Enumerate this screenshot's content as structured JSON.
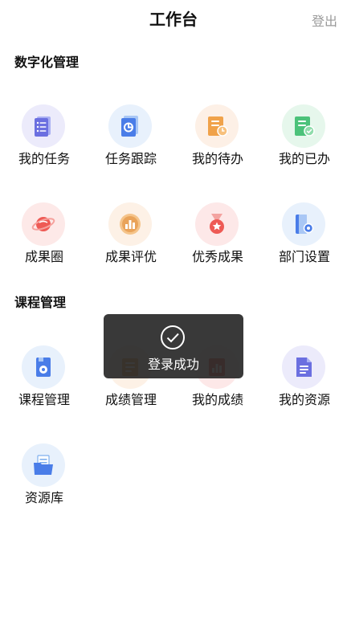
{
  "header": {
    "title": "工作台",
    "logout_label": "登出"
  },
  "sections": {
    "digital": {
      "title": "数字化管理",
      "items": [
        {
          "label": "我的任务",
          "icon": "task-list-icon"
        },
        {
          "label": "任务跟踪",
          "icon": "tracking-icon"
        },
        {
          "label": "我的待办",
          "icon": "todo-clock-icon"
        },
        {
          "label": "我的已办",
          "icon": "done-check-icon"
        },
        {
          "label": "成果圈",
          "icon": "planet-icon"
        },
        {
          "label": "成果评优",
          "icon": "award-chart-icon"
        },
        {
          "label": "优秀成果",
          "icon": "medal-icon"
        },
        {
          "label": "部门设置",
          "icon": "department-settings-icon"
        }
      ]
    },
    "course": {
      "title": "课程管理",
      "items": [
        {
          "label": "课程管理",
          "icon": "course-icon"
        },
        {
          "label": "成绩管理",
          "icon": "grades-icon"
        },
        {
          "label": "我的成绩",
          "icon": "my-grades-icon"
        },
        {
          "label": "我的资源",
          "icon": "document-icon"
        },
        {
          "label": "资源库",
          "icon": "folder-icon"
        }
      ]
    }
  },
  "toast": {
    "message": "登录成功"
  },
  "colors": {
    "title_text": "#111111",
    "logout_text": "#9a9a9a",
    "toast_bg": "#282828",
    "icon_blue": "#4a7de8",
    "icon_purple": "#6b6fe0",
    "icon_orange": "#f0a24a",
    "icon_green": "#4cc27a",
    "icon_red": "#ee5a55"
  }
}
